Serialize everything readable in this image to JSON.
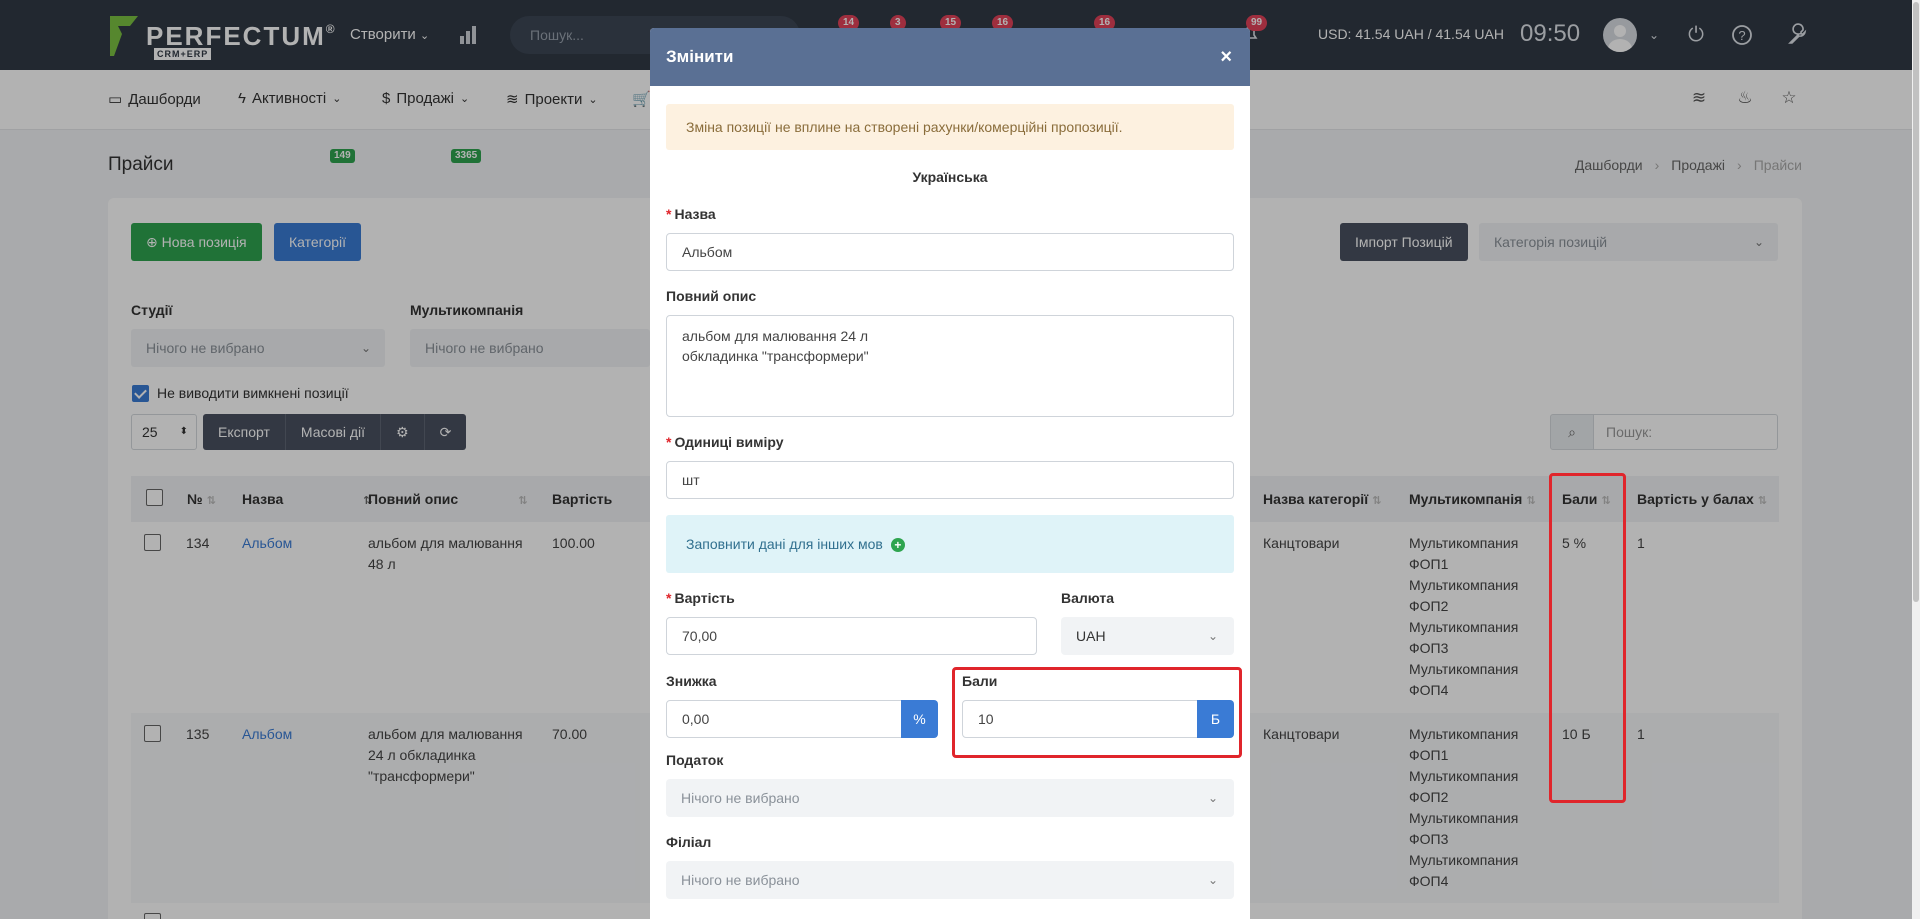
{
  "topbar": {
    "logo_text": "PERFECTUM",
    "logo_reg": "®",
    "logo_sub": "CRM+ERP",
    "create_label": "Створити",
    "search_placeholder": "Пошук...",
    "badges": [
      "14",
      "3",
      "15",
      "16",
      "16"
    ],
    "notif_badge": "99",
    "currency": "USD: 41.54 UAH / 41.54 UAH",
    "time": "09:50"
  },
  "nav": {
    "items": [
      {
        "label": "Дашборди",
        "icon": "monitor-icon"
      },
      {
        "label": "Активності",
        "icon": "lightning-icon",
        "badge": "149"
      },
      {
        "label": "Продажі",
        "icon": "dollar-icon",
        "badge": "3365"
      },
      {
        "label": "Проекти",
        "icon": "layers-icon"
      }
    ]
  },
  "page": {
    "title": "Прайси",
    "breadcrumb": [
      "Дашборди",
      "Продажі",
      "Прайси"
    ],
    "new_item_button": "Нова позиція",
    "categories_button": "Категорії",
    "import_button": "Імпорт Позицій",
    "category_select": "Категорія позицій",
    "filters": {
      "studios_label": "Студії",
      "studios_value": "Нічого не вибрано",
      "multicompany_label": "Мультикомпанія",
      "multicompany_value": "Нічого не вибрано"
    },
    "hide_disabled_label": "Не виводити вимкнені позиції",
    "page_size": "25",
    "export_label": "Експорт",
    "bulk_label": "Масові дії",
    "search_placeholder": "Пошук:"
  },
  "table": {
    "headers": {
      "num": "№",
      "name": "Назва",
      "desc": "Повний опис",
      "price": "Вартість",
      "category": "Назва категорії",
      "multicompany": "Мультикомпанія",
      "points": "Бали",
      "points_price": "Вартість у балах"
    },
    "rows": [
      {
        "num": "134",
        "name": "Альбом",
        "desc": [
          "альбом для малювання",
          "48 л"
        ],
        "price": "100.00",
        "category": "Канцтовари",
        "multicompany": [
          "Мультикомпания",
          "ФОП1",
          "Мультикомпания",
          "ФОП2",
          "Мультикомпания",
          "ФОП3",
          "Мультикомпания",
          "ФОП4"
        ],
        "points": "5 %",
        "points_price": "1"
      },
      {
        "num": "135",
        "name": "Альбом",
        "desc": [
          "альбом для малювання",
          "24 л обкладинка",
          "\"трансформери\""
        ],
        "price": "70.00",
        "category": "Канцтовари",
        "multicompany": [
          "Мультикомпания",
          "ФОП1",
          "Мультикомпания",
          "ФОП2",
          "Мультикомпания",
          "ФОП3",
          "Мультикомпания",
          "ФОП4"
        ],
        "points": "10 Б",
        "points_price": "1"
      }
    ]
  },
  "modal": {
    "title": "Змінити",
    "close": "×",
    "warning": "Зміна позиції не вплине на створені рахунки/комерційні пропозиції.",
    "language": "Українська",
    "name_label": "Назва",
    "name_value": "Альбом",
    "desc_label": "Повний опис",
    "desc_value": "альбом для малювання 24 л\nобкладинка \"трансформери\"",
    "units_label": "Одиниці виміру",
    "units_value": "шт",
    "other_langs": "Заповнити дані для інших мов",
    "price_label": "Вартість",
    "price_value": "70,00",
    "currency_label": "Валюта",
    "currency_value": "UAH",
    "discount_label": "Знижка",
    "discount_value": "0,00",
    "discount_addon": "%",
    "points_label": "Бали",
    "points_value": "10",
    "points_addon": "Б",
    "tax_label": "Податок",
    "tax_value": "Нічого не вибрано",
    "branch_label": "Філіал",
    "branch_value": "Нічого не вибрано",
    "required_mark": "*"
  },
  "colors": {
    "topbar": "#313a46",
    "modal_header": "#5a7094",
    "accent_blue": "#3a7bd5",
    "green": "#2ea44f",
    "highlight_red": "#e0252b"
  }
}
